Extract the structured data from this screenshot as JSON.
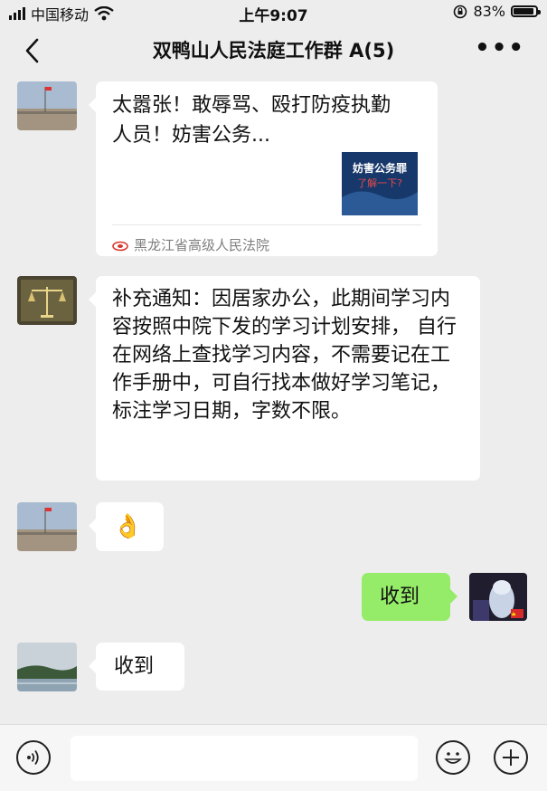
{
  "status_bar": {
    "carrier": "中国移动",
    "time": "上午9:07",
    "battery": "83%",
    "battery_level": 0.83
  },
  "nav": {
    "title": "双鸭山人民法庭工作群 A(5)",
    "back_icon": "chevron-left-icon",
    "more_icon": "more-dots-icon"
  },
  "messages": [
    {
      "side": "left",
      "type": "link-card",
      "title": "太嚣张！敢辱骂、殴打防疫执勤人员！妨害公务...",
      "thumb_text_1": "妨害公务罪",
      "thumb_text_2": "了解一下?",
      "source": "黑龙江省高级人民法院"
    },
    {
      "side": "left",
      "type": "text",
      "text": "补充通知：因居家办公，此期间学习内容按照中院下发的学习计划安排， 自行在网络上查找学习内容，不需要记在工作手册中，可自行找本做好学习笔记，标注学习日期，字数不限。"
    },
    {
      "side": "left",
      "type": "emoji",
      "emoji": "👌"
    },
    {
      "side": "right",
      "type": "text",
      "text": "收到"
    },
    {
      "side": "left",
      "type": "text",
      "text": "收到"
    }
  ],
  "input_bar": {
    "voice_icon": "voice-icon",
    "emoji_icon": "emoji-icon",
    "plus_icon": "plus-icon",
    "placeholder": ""
  },
  "colors": {
    "background": "#ededed",
    "bubble_self": "#95ec69",
    "bubble_other": "#ffffff",
    "source_icon": "#d9362e"
  }
}
